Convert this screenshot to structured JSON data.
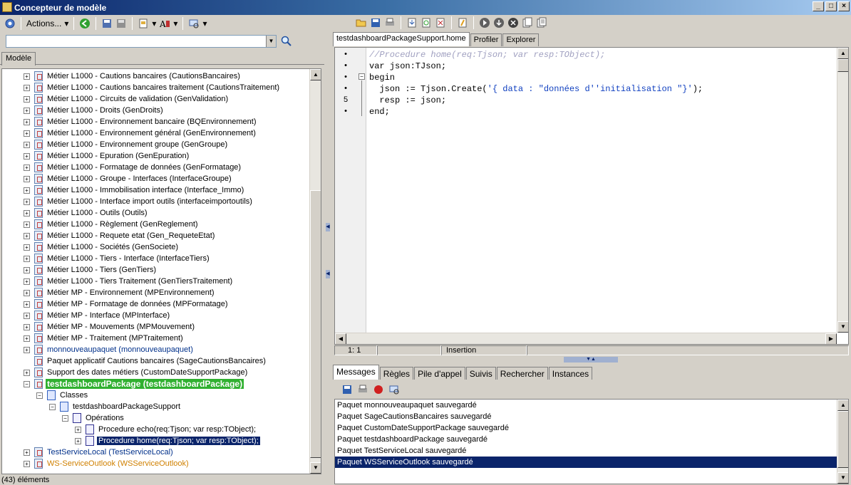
{
  "window": {
    "title": "Concepteur de modèle",
    "buttons": [
      "_",
      "□",
      "×"
    ]
  },
  "left": {
    "toolbar": {
      "actions_label": "Actions...",
      "dropdown_arrow": "▾"
    },
    "search": {
      "value": "",
      "icon": "magnifier-icon"
    },
    "tab_label": "Modèle",
    "tree": [
      {
        "label": "Métier L1000 - Cautions bancaires (CautionsBancaires)",
        "level": 0,
        "exp": "+",
        "icon": "package",
        "style": ""
      },
      {
        "label": "Métier L1000 - Cautions bancaires traitement (CautionsTraitement)",
        "level": 0,
        "exp": "+",
        "icon": "package",
        "style": ""
      },
      {
        "label": "Métier L1000 - Circuits de validation (GenValidation)",
        "level": 0,
        "exp": "+",
        "icon": "package",
        "style": ""
      },
      {
        "label": "Métier L1000 - Droits (GenDroits)",
        "level": 0,
        "exp": "+",
        "icon": "package",
        "style": ""
      },
      {
        "label": "Métier L1000 - Environnement bancaire (BQEnvironnement)",
        "level": 0,
        "exp": "+",
        "icon": "package",
        "style": ""
      },
      {
        "label": "Métier L1000 - Environnement général  (GenEnvironnement)",
        "level": 0,
        "exp": "+",
        "icon": "package",
        "style": ""
      },
      {
        "label": "Métier L1000 - Environnement groupe (GenGroupe)",
        "level": 0,
        "exp": "+",
        "icon": "package",
        "style": ""
      },
      {
        "label": "Métier L1000 - Epuration (GenEpuration)",
        "level": 0,
        "exp": "+",
        "icon": "package",
        "style": ""
      },
      {
        "label": "Métier L1000 - Formatage de données (GenFormatage)",
        "level": 0,
        "exp": "+",
        "icon": "package",
        "style": ""
      },
      {
        "label": "Métier L1000 - Groupe - Interfaces (InterfaceGroupe)",
        "level": 0,
        "exp": "+",
        "icon": "package",
        "style": ""
      },
      {
        "label": "Métier L1000 - Immobilisation interface (Interface_Immo)",
        "level": 0,
        "exp": "+",
        "icon": "package",
        "style": ""
      },
      {
        "label": "Métier L1000 - Interface import outils (interfaceimportoutils)",
        "level": 0,
        "exp": "+",
        "icon": "package",
        "style": ""
      },
      {
        "label": "Métier L1000 - Outils (Outils)",
        "level": 0,
        "exp": "+",
        "icon": "package",
        "style": ""
      },
      {
        "label": "Métier L1000 - Règlement (GenReglement)",
        "level": 0,
        "exp": "+",
        "icon": "package",
        "style": ""
      },
      {
        "label": "Métier L1000 - Requete etat (Gen_RequeteEtat)",
        "level": 0,
        "exp": "+",
        "icon": "package",
        "style": ""
      },
      {
        "label": "Métier L1000 - Sociétés (GenSociete)",
        "level": 0,
        "exp": "+",
        "icon": "package",
        "style": ""
      },
      {
        "label": "Métier L1000 - Tiers - Interface (InterfaceTiers)",
        "level": 0,
        "exp": "+",
        "icon": "package",
        "style": ""
      },
      {
        "label": "Métier L1000 - Tiers (GenTiers)",
        "level": 0,
        "exp": "+",
        "icon": "package",
        "style": ""
      },
      {
        "label": "Métier L1000 - Tiers Traitement (GenTiersTraitement)",
        "level": 0,
        "exp": "+",
        "icon": "package",
        "style": ""
      },
      {
        "label": "Métier MP - Environnement (MPEnvironnement)",
        "level": 0,
        "exp": "+",
        "icon": "package",
        "style": ""
      },
      {
        "label": "Métier MP - Formatage de données (MPFormatage)",
        "level": 0,
        "exp": "+",
        "icon": "package",
        "style": ""
      },
      {
        "label": "Métier MP - Interface (MPInterface)",
        "level": 0,
        "exp": "+",
        "icon": "package",
        "style": ""
      },
      {
        "label": "Métier MP - Mouvements (MPMouvement)",
        "level": 0,
        "exp": "+",
        "icon": "package",
        "style": ""
      },
      {
        "label": "Métier MP - Traitement (MPTraitement)",
        "level": 0,
        "exp": "+",
        "icon": "package",
        "style": ""
      },
      {
        "label": "monnouveaupaquet (monnouveaupaquet)",
        "level": 0,
        "exp": "+",
        "icon": "package",
        "style": "blue"
      },
      {
        "label": "Paquet applicatif Cautions bancaires (SageCautionsBancaires)",
        "level": 0,
        "exp": "",
        "icon": "package",
        "style": ""
      },
      {
        "label": "Support des dates métiers (CustomDateSupportPackage)",
        "level": 0,
        "exp": "+",
        "icon": "package",
        "style": ""
      },
      {
        "label": "testdashboardPackage (testdashboardPackage)",
        "level": 0,
        "exp": "-",
        "icon": "package",
        "style": "green"
      },
      {
        "label": "Classes",
        "level": 1,
        "exp": "-",
        "icon": "class",
        "style": ""
      },
      {
        "label": "testdashboardPackageSupport",
        "level": 2,
        "exp": "-",
        "icon": "class",
        "style": ""
      },
      {
        "label": "Opérations",
        "level": 3,
        "exp": "-",
        "icon": "ops",
        "style": ""
      },
      {
        "label": "Procedure echo(req:Tjson; var resp:TObject);",
        "level": 4,
        "exp": "+",
        "icon": "ops",
        "style": ""
      },
      {
        "label": "Procedure home(req:Tjson; var resp:TObject);",
        "level": 4,
        "exp": "+",
        "icon": "ops",
        "style": "selected"
      },
      {
        "label": "TestServiceLocal (TestServiceLocal)",
        "level": 0,
        "exp": "+",
        "icon": "package",
        "style": "blue"
      },
      {
        "label": "WS-ServiceOutlook (WSServiceOutlook)",
        "level": 0,
        "exp": "+",
        "icon": "package",
        "style": "orange"
      }
    ],
    "status": "(43) éléments"
  },
  "right": {
    "tabs": [
      {
        "label": "testdashboardPackageSupport.home",
        "active": true
      },
      {
        "label": "Profiler",
        "active": false
      },
      {
        "label": "Explorer",
        "active": false
      }
    ],
    "gutter": [
      "•",
      "•",
      "•",
      "•",
      "5",
      "•"
    ],
    "code_lines": [
      {
        "text": "//Procedure home(req:Tjson; var resp:TObject);",
        "kind": "comment"
      },
      {
        "text": "var json:TJson;",
        "kind": "code"
      },
      {
        "text": "begin",
        "kind": "code"
      },
      {
        "text": "  json := Tjson.Create(",
        "kind": "code",
        "str": "'{ data : \"données d''initialisation \"}'",
        "tail": ");"
      },
      {
        "text": "  resp := json;",
        "kind": "code"
      },
      {
        "text": "end;",
        "kind": "code"
      }
    ],
    "editor_status": {
      "position": "1:  1",
      "mode": "Insertion"
    },
    "bottom_tabs": [
      {
        "label": "Messages",
        "active": true
      },
      {
        "label": "Règles",
        "active": false
      },
      {
        "label": "Pile d'appel",
        "active": false
      },
      {
        "label": "Suivis",
        "active": false
      },
      {
        "label": "Rechercher",
        "active": false
      },
      {
        "label": "Instances",
        "active": false
      }
    ],
    "messages": [
      {
        "text": "Paquet monnouveaupaquet sauvegardé",
        "selected": false
      },
      {
        "text": "Paquet SageCautionsBancaires sauvegardé",
        "selected": false
      },
      {
        "text": "Paquet CustomDateSupportPackage sauvegardé",
        "selected": false
      },
      {
        "text": "Paquet testdashboardPackage sauvegardé",
        "selected": false
      },
      {
        "text": "Paquet TestServiceLocal sauvegardé",
        "selected": false
      },
      {
        "text": "Paquet WSServiceOutlook sauvegardé",
        "selected": true
      }
    ]
  }
}
